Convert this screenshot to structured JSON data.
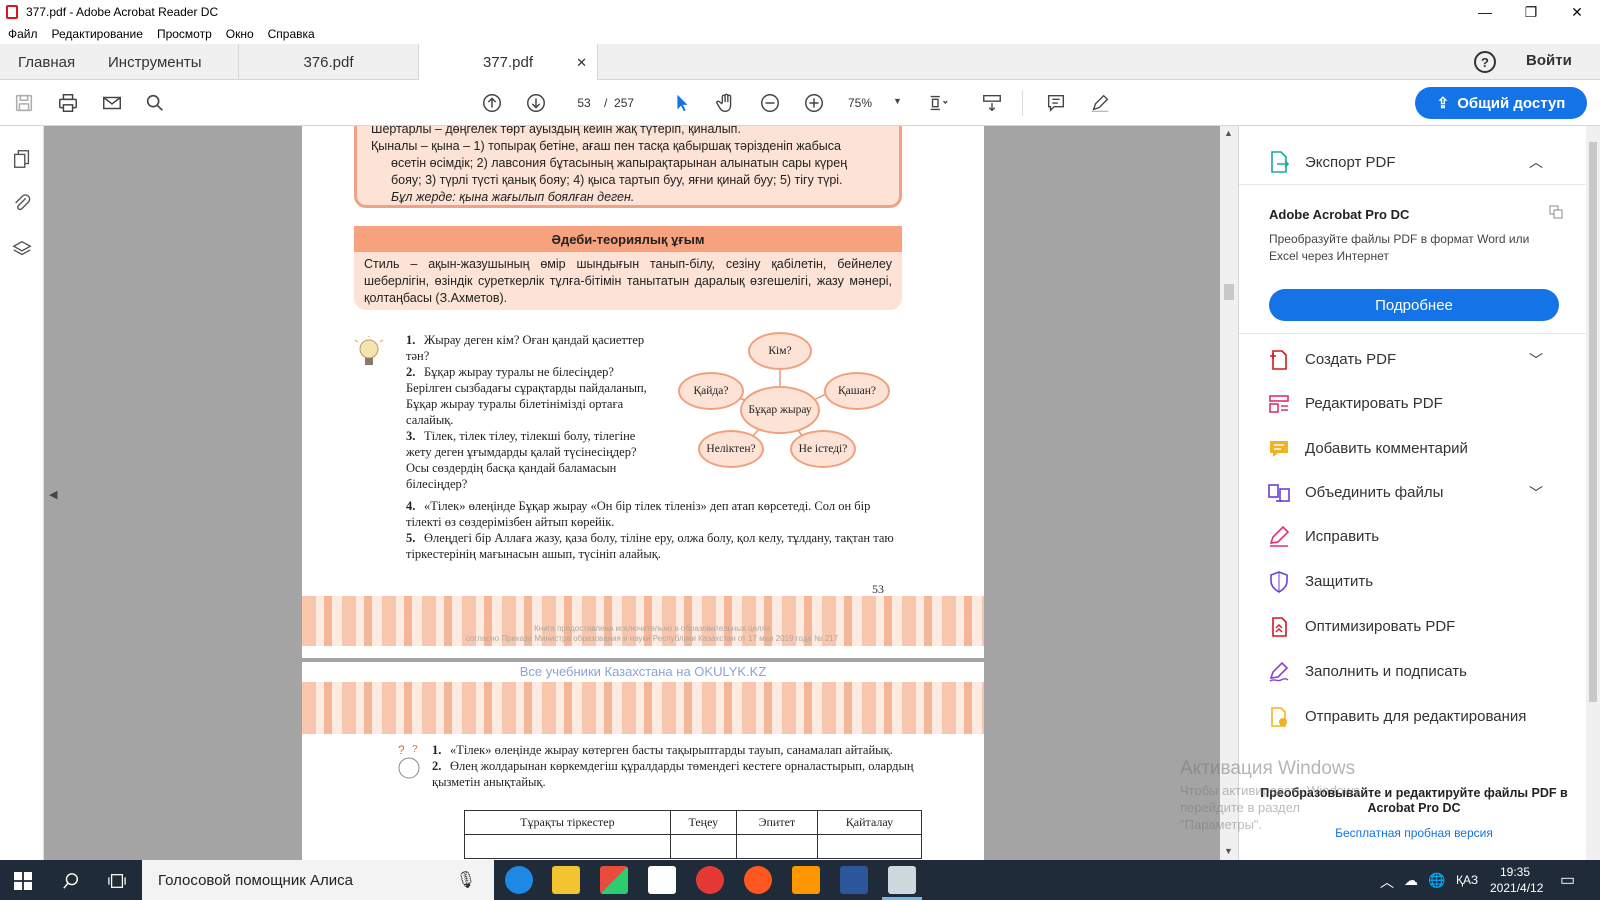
{
  "window": {
    "title": "377.pdf - Adobe Acrobat Reader DC",
    "controls": {
      "minimize": "—",
      "restore": "❐",
      "close": "✕"
    }
  },
  "menu": [
    "Файл",
    "Редактирование",
    "Просмотр",
    "Окно",
    "Справка"
  ],
  "tabs": {
    "home": "Главная",
    "tools": "Инструменты",
    "doc1": "376.pdf",
    "doc2": "377.pdf",
    "close": "✕"
  },
  "header_right": {
    "help": "?",
    "signin": "Войти"
  },
  "toolbar": {
    "page_current": "53",
    "page_sep": "/",
    "page_total": "257",
    "zoom": "75%",
    "share_label": "Общий доступ"
  },
  "document": {
    "page1": {
      "top_box_lines": [
        "Шертарлы – дөңгелек төрт ауыздың кейін жақ түтеріп, қиналып.",
        "Қыналы – қына – 1) топырақ бетіне, ағаш пен тасқа қабыршақ тәрізденіп жабыса",
        "өсетін өсімдік; 2) лавсония бұтасының жапырақтарынан алынатын сары күрең",
        "бояу; 3) түрлі түсті қанық бояу; 4) қыса тартып буу, яғни қинай буу; 5) тігу түрі.",
        "Бұл жерде: қына жағылып боялған деген."
      ],
      "theory_title": "Әдеби-теориялық ұғым",
      "theory_text": "Стиль – ақын-жазушының өмір шындығын танып-білу, сезіну қабілетін, бейнелеу шеберлігін, өзіндік суреткерлік тұлға-бітімін танытатын даралық өзгешелігі, жазу мәнері, қолтаңбасы (З.Ахметов).",
      "questions_narrow": [
        {
          "num": "1.",
          "text": "Жырау деген кім? Оған қандай қасиеттер тән?"
        },
        {
          "num": "2.",
          "text": "Бұқар жырау туралы не білесіңдер? Берілген сызбадағы сұрақтарды пайдаланып, Бұқар жырау туралы білетініміздi ортаға салайық."
        },
        {
          "num": "3.",
          "text": "Тілек, тілек тілеу, тілекші болу, тілегіне жету деген ұғымдарды қалай түсінесіңдер? Осы сөздердің басқа қандай баламасын білесіңдер?"
        }
      ],
      "questions_wide": [
        {
          "num": "4.",
          "text": "«Тілек» өлеңінде Бұқар жырау «Он бір тілек тіленіз» деп атап көрсетеді. Сол он бір тілекті өз сөздерімізбен айтып көрейік."
        },
        {
          "num": "5.",
          "text": "Өлеңдегі бір Аллаға жазу, қаза болу, тіліне еру, олжа болу, қол келу, тұлдану, тақтан таю тіркестерінің мағынасын ашып, түсініп алайық."
        }
      ],
      "mindmap": {
        "center": "Бұқар жырау",
        "kim": "Кім?",
        "kaida": "Қайда?",
        "kashan": "Қашан?",
        "nelikten": "Неліктен?",
        "ne_istedi": "Не істеді?"
      },
      "page_number": "53",
      "watermark_line1": "Книга предоставлена исключительно в образовательных целях",
      "watermark_line2": "согласно Приказа Министра образования и науки Республики Казахстан от 17 мая 2019 года № 217"
    },
    "page2": {
      "site_note": "Все учебники Казахстана на OKULYK.KZ",
      "questions": [
        {
          "num": "1.",
          "text": "«Тілек» өлеңінде жырау көтерген басты тақырыптарды тауып, санамалап айтайық."
        },
        {
          "num": "2.",
          "text": "Өлең жолдарынан көркемдегіш құралдарды төмендегі кестеге орналастырып, олардың қызметін анықтайық."
        }
      ],
      "table_headers": [
        "Тұрақты тіркестер",
        "Теңеу",
        "Эпитет",
        "Қайталау"
      ]
    }
  },
  "right_panel": {
    "export_label": "Экспорт PDF",
    "pro_title": "Adobe Acrobat Pro DC",
    "pro_desc": "Преобразуйте файлы PDF в формат Word или Excel через Интернет",
    "pro_button": "Подробнее",
    "tools": [
      {
        "label": "Создать PDF",
        "icon": "create-pdf-icon",
        "color": "#d8161e",
        "expand": true
      },
      {
        "label": "Редактировать PDF",
        "icon": "edit-pdf-icon",
        "color": "#e3306c",
        "expand": false
      },
      {
        "label": "Добавить комментарий",
        "icon": "comment-icon",
        "color": "#f0b323",
        "expand": false
      },
      {
        "label": "Объединить файлы",
        "icon": "combine-files-icon",
        "color": "#6b3fd6",
        "expand": true
      },
      {
        "label": "Исправить",
        "icon": "fill-sign-pen-icon",
        "color": "#e3306c",
        "expand": false
      },
      {
        "label": "Защитить",
        "icon": "shield-icon",
        "color": "#6b3fd6",
        "expand": false
      },
      {
        "label": "Оптимизировать PDF",
        "icon": "optimize-pdf-icon",
        "color": "#d8161e",
        "expand": false
      },
      {
        "label": "Заполнить и подписать",
        "icon": "sign-icon",
        "color": "#8a3fd6",
        "expand": false
      },
      {
        "label": "Отправить для редактирования",
        "icon": "send-for-review-icon",
        "color": "#f0b323",
        "expand": false
      }
    ],
    "bottom_text": "Преобразовывайте и редактируйте файлы PDF в Acrobat Pro DC",
    "trial_link": "Бесплатная пробная версия"
  },
  "windows_activation": {
    "title": "Активация Windows",
    "text": "Чтобы активировать Windows, перейдите в раздел \"Параметры\"."
  },
  "taskbar": {
    "search_text": "Голосовой помощник Алиса",
    "lang": "ҚАЗ",
    "time": "19:35",
    "date": "2021/4/12"
  },
  "colors": {
    "accent_blue": "#1473e6",
    "peach": "#fce3d6",
    "orange_head": "#f6a27f",
    "acrobat_red": "#d8161e"
  }
}
